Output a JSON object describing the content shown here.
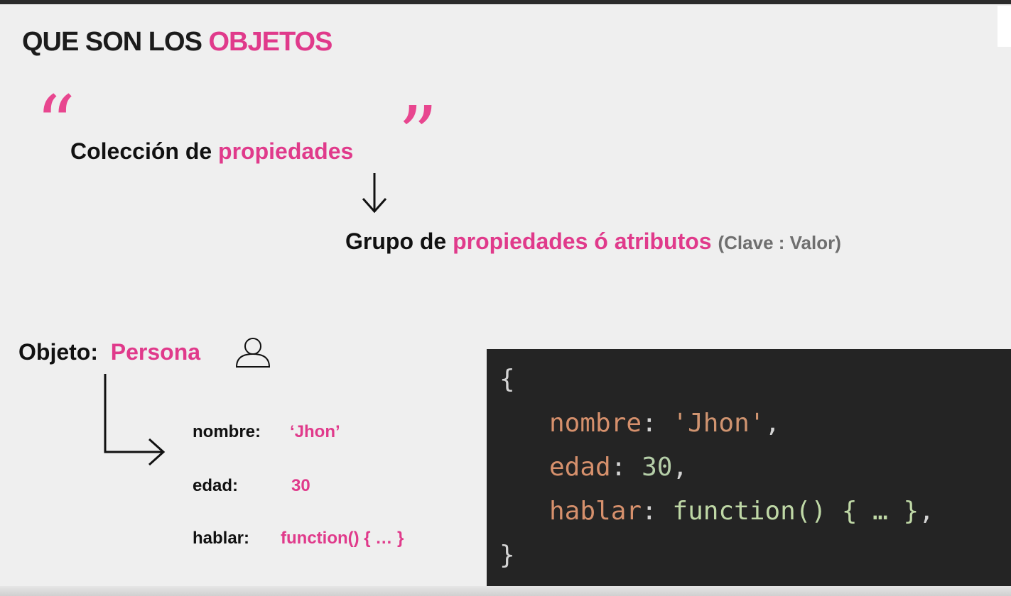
{
  "title": {
    "prefix": "QUE SON LOS ",
    "highlight": "OBJETOS"
  },
  "definition": {
    "line1_prefix": "Colección de",
    "line1_highlight": "propiedades",
    "line2_prefix": "Grupo de",
    "line2_highlight": "propiedades ó atributos",
    "line2_note": "(Clave : Valor)"
  },
  "quotes": {
    "open": "“",
    "close": "”"
  },
  "example": {
    "label": "Objeto:",
    "name": "Persona",
    "icon": "user-icon",
    "properties": [
      {
        "key": "nombre:",
        "value": "‘Jhon’"
      },
      {
        "key": "edad:",
        "value": "30"
      },
      {
        "key": "hablar:",
        "value": "function() { … }"
      }
    ]
  },
  "code": {
    "open_brace": "{",
    "close_brace": "}",
    "lines": [
      {
        "key": "nombre",
        "sep": ": ",
        "value": "'Jhon'",
        "end": ","
      },
      {
        "key": "edad",
        "sep": ": ",
        "value": "30",
        "end": ","
      },
      {
        "key": "hablar",
        "sep": ": ",
        "value": "function() { … }",
        "end": ","
      }
    ]
  },
  "colors": {
    "accent": "#e03a8b",
    "code_bg": "#242424",
    "background": "#efefef"
  }
}
